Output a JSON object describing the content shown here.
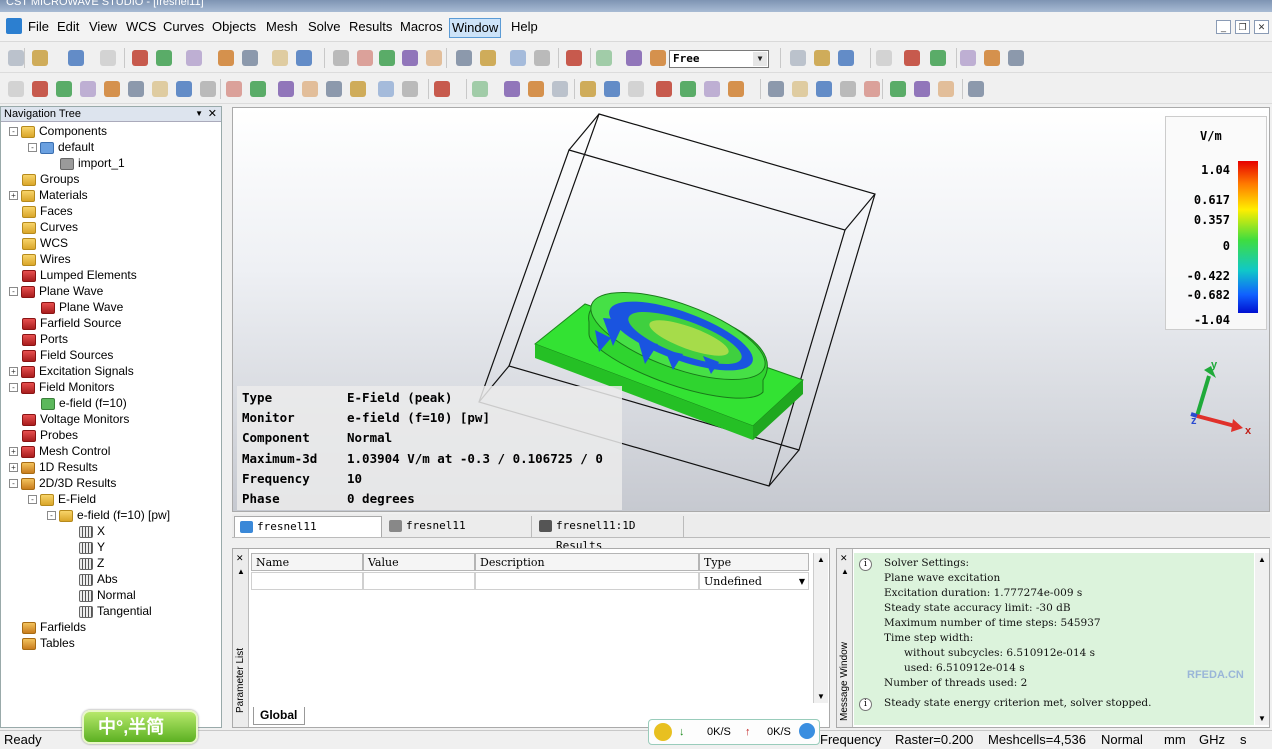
{
  "window": {
    "title": "CST MICROWAVE STUDIO - [fresnel11]"
  },
  "menu": [
    "File",
    "Edit",
    "View",
    "WCS",
    "Curves",
    "Objects",
    "Mesh",
    "Solve",
    "Results",
    "Macros",
    "Window",
    "Help"
  ],
  "active_menu": "Window",
  "toolbar": {
    "view_mode": "Free"
  },
  "nav_tree": {
    "title": "Navigation Tree",
    "items": [
      {
        "label": "Components",
        "level": 0,
        "exp": "-",
        "icon": "folder"
      },
      {
        "label": "default",
        "level": 1,
        "exp": "-",
        "icon": "blue"
      },
      {
        "label": "import_1",
        "level": 2,
        "exp": "",
        "icon": "gray"
      },
      {
        "label": "Groups",
        "level": 0,
        "exp": "",
        "icon": "folder"
      },
      {
        "label": "Materials",
        "level": 0,
        "exp": "+",
        "icon": "folder"
      },
      {
        "label": "Faces",
        "level": 0,
        "exp": "",
        "icon": "folder"
      },
      {
        "label": "Curves",
        "level": 0,
        "exp": "",
        "icon": "folder"
      },
      {
        "label": "WCS",
        "level": 0,
        "exp": "",
        "icon": "folder"
      },
      {
        "label": "Wires",
        "level": 0,
        "exp": "",
        "icon": "folder"
      },
      {
        "label": "Lumped Elements",
        "level": 0,
        "exp": "",
        "icon": "red"
      },
      {
        "label": "Plane Wave",
        "level": 0,
        "exp": "-",
        "icon": "red"
      },
      {
        "label": "Plane Wave",
        "level": 1,
        "exp": "",
        "icon": "red"
      },
      {
        "label": "Farfield Source",
        "level": 0,
        "exp": "",
        "icon": "red"
      },
      {
        "label": "Ports",
        "level": 0,
        "exp": "",
        "icon": "red"
      },
      {
        "label": "Field Sources",
        "level": 0,
        "exp": "",
        "icon": "red"
      },
      {
        "label": "Excitation Signals",
        "level": 0,
        "exp": "+",
        "icon": "red"
      },
      {
        "label": "Field Monitors",
        "level": 0,
        "exp": "-",
        "icon": "red"
      },
      {
        "label": "e-field (f=10)",
        "level": 1,
        "exp": "",
        "icon": "green"
      },
      {
        "label": "Voltage Monitors",
        "level": 0,
        "exp": "",
        "icon": "red"
      },
      {
        "label": "Probes",
        "level": 0,
        "exp": "",
        "icon": "red"
      },
      {
        "label": "Mesh Control",
        "level": 0,
        "exp": "+",
        "icon": "red"
      },
      {
        "label": "1D Results",
        "level": 0,
        "exp": "+",
        "icon": "fwave"
      },
      {
        "label": "2D/3D Results",
        "level": 0,
        "exp": "-",
        "icon": "fwave"
      },
      {
        "label": "E-Field",
        "level": 1,
        "exp": "-",
        "icon": "folder"
      },
      {
        "label": "e-field (f=10) [pw]",
        "level": 2,
        "exp": "-",
        "icon": "folder"
      },
      {
        "label": "X",
        "level": 3,
        "exp": "",
        "icon": "wave"
      },
      {
        "label": "Y",
        "level": 3,
        "exp": "",
        "icon": "wave"
      },
      {
        "label": "Z",
        "level": 3,
        "exp": "",
        "icon": "wave"
      },
      {
        "label": "Abs",
        "level": 3,
        "exp": "",
        "icon": "wave"
      },
      {
        "label": "Normal",
        "level": 3,
        "exp": "",
        "icon": "wave"
      },
      {
        "label": "Tangential",
        "level": 3,
        "exp": "",
        "icon": "wave"
      },
      {
        "label": "Farfields",
        "level": 0,
        "exp": "",
        "icon": "fwave"
      },
      {
        "label": "Tables",
        "level": 0,
        "exp": "",
        "icon": "fwave"
      }
    ]
  },
  "result_info": [
    {
      "key": "Type",
      "value": "E-Field (peak)"
    },
    {
      "key": "Monitor",
      "value": "e-field (f=10) [pw]"
    },
    {
      "key": "Component",
      "value": "Normal"
    },
    {
      "key": "Maximum-3d",
      "value": "1.03904 V/m at -0.3 / 0.106725 / 0"
    },
    {
      "key": "Frequency",
      "value": "10"
    },
    {
      "key": "Phase",
      "value": "0 degrees"
    }
  ],
  "legend": {
    "unit": "V/m",
    "ticks": [
      "1.04",
      "0.617",
      "0.357",
      "0",
      "-0.422",
      "-0.682",
      "-1.04"
    ]
  },
  "axes": {
    "x": "x",
    "y": "y",
    "z": "z"
  },
  "view_tabs": [
    "fresnel11",
    "fresnel11",
    "fresnel11:1D Results"
  ],
  "param_list": {
    "title": "Parameter List",
    "columns": [
      "Name",
      "Value",
      "Description",
      "Type"
    ],
    "row_type": "Undefined",
    "tab": "Global"
  },
  "message_window": {
    "title": "Message Window",
    "messages": [
      {
        "lines": [
          "Solver Settings:",
          "Plane wave excitation",
          "Excitation duration: 1.777274e-009 s",
          "Steady state accuracy limit: -30 dB",
          "Maximum number of time steps: 545937",
          "Time step width:",
          "      without subcycles: 6.510912e-014 s",
          "      used: 6.510912e-014 s",
          "Number of threads used: 2"
        ]
      },
      {
        "lines": [
          "Steady state energy criterion met, solver stopped."
        ]
      }
    ]
  },
  "status": {
    "left": "Ready",
    "frequency": "Frequency",
    "raster": "Raster=0.200",
    "meshcells": "Meshcells=4,536",
    "mode": "Normal",
    "len_unit": "mm",
    "freq_unit": "GHz",
    "time_unit": "s"
  },
  "ime": {
    "label": "中°,半简"
  },
  "speed": {
    "down": "0K/S",
    "up": "0K/S"
  },
  "watermark": {
    "text": "RFEDA.CN"
  }
}
